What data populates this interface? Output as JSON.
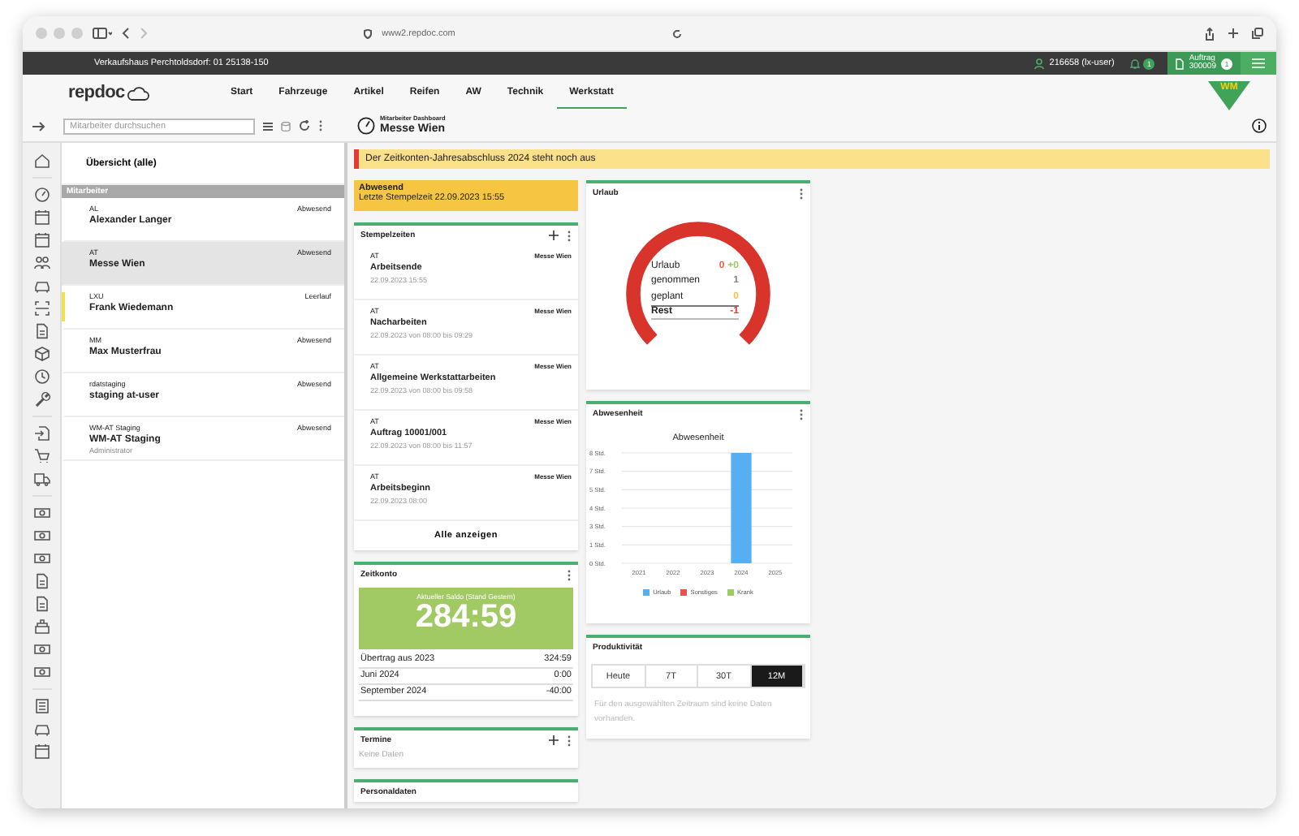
{
  "browser": {
    "url": "www2.repdoc.com"
  },
  "topbar": {
    "branch": "Verkaufshaus Perchtoldsdorf: 01 25138-150",
    "user": "216658 (lx-user)",
    "notifications": "1",
    "order": {
      "label": "Auftrag",
      "number": "300009",
      "badge": "1"
    }
  },
  "nav": {
    "logo": "repdoc",
    "brand_logo": "WM",
    "items": [
      {
        "label": "Start",
        "selected": false
      },
      {
        "label": "Fahrzeuge",
        "selected": false
      },
      {
        "label": "Artikel",
        "selected": false
      },
      {
        "label": "Reifen",
        "selected": false
      },
      {
        "label": "AW",
        "selected": false
      },
      {
        "label": "Technik",
        "selected": false
      },
      {
        "label": "Werkstatt",
        "selected": true
      }
    ]
  },
  "toolbar": {
    "search_placeholder": "Mitarbeiter durchsuchen"
  },
  "dashboard": {
    "subtitle": "Mitarbeiter Dashboard",
    "title": "Messe Wien"
  },
  "employee_list": {
    "overview": "Übersicht (alle)",
    "section": "Mitarbeiter",
    "items": [
      {
        "code": "AL",
        "name": "Alexander Langer",
        "status": "Abwesend",
        "selected": false
      },
      {
        "code": "AT",
        "name": "Messe Wien",
        "status": "Abwesend",
        "selected": true
      },
      {
        "code": "LXU",
        "name": "Frank Wiedemann",
        "status": "Leerlauf",
        "selected": false,
        "color": "#f2e24a"
      },
      {
        "code": "MM",
        "name": "Max Musterfrau",
        "status": "Abwesend",
        "selected": false
      },
      {
        "code": "rdatstaging",
        "name": "staging at-user",
        "status": "Abwesend",
        "selected": false
      },
      {
        "code": "WM-AT Staging",
        "name": "WM-AT Staging",
        "status": "Abwesend",
        "selected": false,
        "role": "Administrator"
      }
    ]
  },
  "banner": "Der Zeitkonten-Jahresabschluss 2024 steht noch aus",
  "status_card": {
    "status": "Abwesend",
    "last_stamp": "Letzte Stempelzeit 22.09.2023 15:55"
  },
  "stempelzeiten": {
    "title": "Stempelzeiten",
    "show_all": "Alle anzeigen",
    "entries": [
      {
        "code": "AT",
        "location": "Messe Wien",
        "title": "Arbeitsende",
        "time": "22.09.2023 15:55"
      },
      {
        "code": "AT",
        "location": "Messe Wien",
        "title": "Nacharbeiten",
        "time": "22.09.2023 von 08:00 bis 09:29"
      },
      {
        "code": "AT",
        "location": "Messe Wien",
        "title": "Allgemeine Werkstattarbeiten",
        "time": "22.09.2023 von 08:00 bis 09:58"
      },
      {
        "code": "AT",
        "location": "Messe Wien",
        "title": "Auftrag 10001/001",
        "time": "22.09.2023 von 08:00 bis 11:57"
      },
      {
        "code": "AT",
        "location": "Messe Wien",
        "title": "Arbeitsbeginn",
        "time": "22.09.2023 08:00"
      }
    ]
  },
  "zeitkonto": {
    "title": "Zeitkonto",
    "balance_label": "Aktueller Saldo (Stand Gestern)",
    "balance": "284:59",
    "rows": [
      {
        "label": "Übertrag aus 2023",
        "value": "324:59"
      },
      {
        "label": "Juni 2024",
        "value": "0:00"
      },
      {
        "label": "September 2024",
        "value": "-40:00"
      }
    ]
  },
  "termine": {
    "title": "Termine",
    "empty": "Keine Daten"
  },
  "personaldaten": {
    "title": "Personaldaten"
  },
  "urlaub": {
    "title": "Urlaub",
    "rows": [
      {
        "kind": "line",
        "label": "Urlaub",
        "values": [
          {
            "text": "0",
            "color": "#e8604f"
          },
          {
            "text": "+0",
            "color": "#9ccc65"
          }
        ]
      },
      {
        "kind": "line",
        "label": "genommen",
        "values": [
          {
            "text": "1",
            "color": "#888888"
          }
        ]
      },
      {
        "kind": "line",
        "label": "geplant",
        "values": [
          {
            "text": "0",
            "color": "#f5c242"
          }
        ]
      },
      {
        "kind": "total",
        "label": "Rest",
        "values": [
          {
            "text": "-1",
            "color": "#e53935"
          }
        ]
      }
    ]
  },
  "abwesenheit": {
    "title": "Abwesenheit",
    "chart_data": {
      "type": "bar",
      "grid": true,
      "title": "Abwesenheit",
      "categories": [
        "2021",
        "2022",
        "2023",
        "2024",
        "2025"
      ],
      "ylim": [
        0,
        8
      ],
      "yticks": [
        {
          "value": 0,
          "label": "0 Std."
        },
        {
          "value": 1.33,
          "label": "1 Std."
        },
        {
          "value": 2.67,
          "label": "3 Std."
        },
        {
          "value": 4,
          "label": "4 Std."
        },
        {
          "value": 5.33,
          "label": "5 Std."
        },
        {
          "value": 6.67,
          "label": "7 Std."
        },
        {
          "value": 8,
          "label": "8 Std."
        }
      ],
      "series": [
        {
          "name": "Urlaub",
          "color": "#55aff0",
          "values": [
            0,
            0,
            0,
            8,
            0
          ]
        },
        {
          "name": "Sonstiges",
          "color": "#e5554b",
          "values": [
            0,
            0,
            0,
            0,
            0
          ]
        },
        {
          "name": "Krank",
          "color": "#9ccc65",
          "values": [
            0,
            0,
            0,
            0,
            0
          ]
        }
      ]
    }
  },
  "produktivitaet": {
    "title": "Produktivität",
    "message": "Für den ausgewählten Zeitraum sind keine Daten vorhanden.",
    "ranges": [
      {
        "label": "Heute",
        "selected": false
      },
      {
        "label": "7T",
        "selected": false
      },
      {
        "label": "30T",
        "selected": false
      },
      {
        "label": "12M",
        "selected": true
      }
    ]
  }
}
